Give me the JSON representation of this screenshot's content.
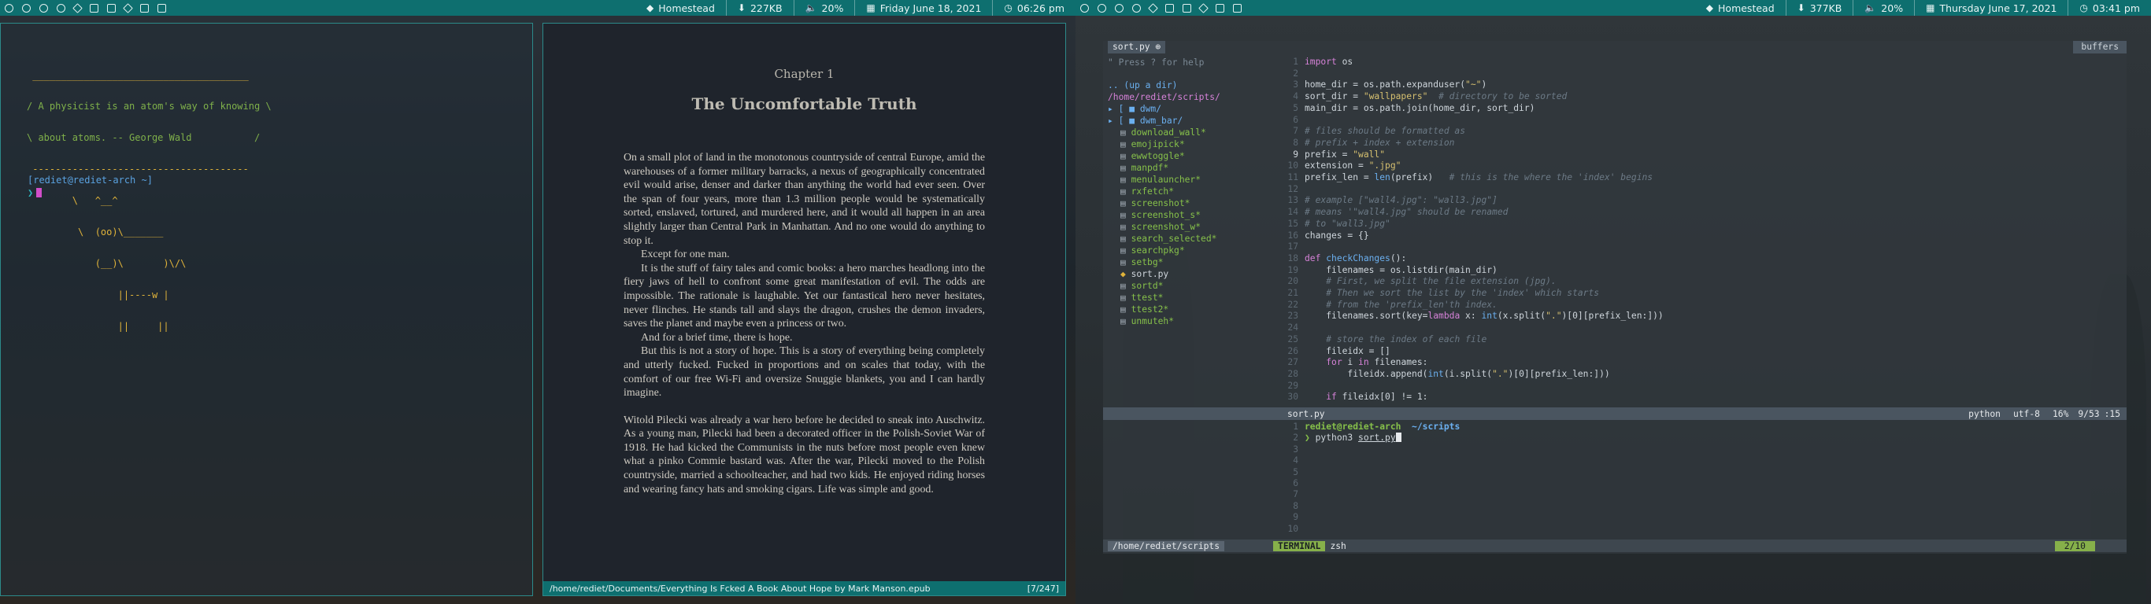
{
  "left_bar": {
    "network": "Homestead",
    "download": "227KB",
    "volume": "20%",
    "date": "Friday June 18, 2021",
    "time": "06:26 pm"
  },
  "right_bar": {
    "network": "Homestead",
    "download": "377KB",
    "volume": "20%",
    "date": "Thursday June 17, 2021",
    "time": "03:41 pm"
  },
  "terminal1": {
    "cowsay": [
      " ______________________________________",
      "/ A physicist is an atom's way of knowing \\",
      "\\ about atoms. -- George Wald           /",
      " --------------------------------------",
      "        \\   ^__^",
      "         \\  (oo)\\_______",
      "            (__)\\       )\\/\\",
      "                ||----w |",
      "                ||     ||"
    ],
    "prompt": "[rediet@rediet-arch ~",
    "prompt_end": "]",
    "cursor_glyph": "❯"
  },
  "reader": {
    "chapter": "Chapter 1",
    "title": "The Uncomfortable Truth",
    "paragraphs": [
      "On a small plot of land in the monotonous countryside of central Europe, amid the warehouses of a former military barracks, a nexus of geographically concentrated evil would arise, denser and darker than anything the world had ever seen. Over the span of four years, more than 1.3 million people would be systematically sorted, enslaved, tortured, and murdered here, and it would all happen in an area slightly larger than Central Park in Manhattan. And no one would do anything to stop it.",
      "Except for one man.",
      "It is the stuff of fairy tales and comic books: a hero marches headlong into the fiery jaws of hell to confront some great manifestation of evil. The odds are impossible. The rationale is laughable. Yet our fantastical hero never hesitates, never flinches. He stands tall and slays the dragon, crushes the demon invaders, saves the planet and maybe even a princess or two.",
      "And for a brief time, there is hope.",
      "But this is not a story of hope. This is a story of everything being completely and utterly fucked. Fucked in proportions and on scales that today, with the comfort of our free Wi-Fi and oversize Snuggie blankets, you and I can hardly imagine.",
      "Witold Pilecki was already a war hero before he decided to sneak into Auschwitz. As a young man, Pilecki had been a decorated officer in the Polish-Soviet War of 1918. He had kicked the Communists in the nuts before most people even knew what a pinko Commie bastard was. After the war, Pilecki moved to the Polish countryside, married a schoolteacher, and had two kids. He enjoyed riding horses and wearing fancy hats and smoking cigars. Life was simple and good."
    ],
    "path": "/home/rediet/Documents/Everything Is Fcked A Book About Hope by Mark Manson.epub",
    "page": "[7/247]"
  },
  "nvim": {
    "tab_name": "sort.py",
    "buffers_label": "buffers",
    "tree_help": "\" Press ? for help",
    "tree_up": ".. (up a dir)",
    "tree_cwd": "/home/rediet/scripts/",
    "tree_dirs": [
      "dwm/",
      "dwm_bar/"
    ],
    "tree_files": [
      "download_wall*",
      "emojipick*",
      "ewwtoggle*",
      "manpdf*",
      "menulauncher*",
      "rxfetch*",
      "screenshot*",
      "screenshot_s*",
      "screenshot_w*",
      "search_selected*",
      "searchpkg*",
      "setbg*",
      "sort.py",
      "sortd*",
      "ttest*",
      "ttest2*",
      "unmuteh*"
    ],
    "code_lines": [
      "import os",
      "",
      "home_dir = os.path.expanduser(\"~\")",
      "sort_dir = \"wallpapers\"  # directory to be sorted",
      "main_dir = os.path.join(home_dir, sort_dir)",
      "",
      "# files should be formatted as",
      "# prefix + index + extension",
      "prefix = \"wall\"",
      "extension = \".jpg\"",
      "prefix_len = len(prefix)   # this is the where the 'index' begins",
      "",
      "# example [\"wall4.jpg\": \"wall3.jpg\"]",
      "# means '\"wall4.jpg\" should be renamed",
      "# to \"wall3.jpg\"",
      "changes = {}",
      "",
      "def checkChanges():",
      "    filenames = os.listdir(main_dir)",
      "    # First, we split the file extension (jpg).",
      "    # Then we sort the list by the 'index' which starts",
      "    # from the 'prefix_len'th index.",
      "    filenames.sort(key=lambda x: int(x.split(\".\")[0][prefix_len:]))",
      "",
      "    # store the index of each file",
      "    fileidx = []",
      "    for i in filenames:",
      "        fileidx.append(int(i.split(\".\")[0][prefix_len:]))",
      "",
      "    if fileidx[0] != 1:"
    ],
    "status_file": "sort.py",
    "status_ft": "python",
    "status_enc": "utf-8",
    "status_pct": "16%",
    "status_pos": "9/53",
    "status_col": ":15",
    "term_prompt_user": "rediet@rediet-arch",
    "term_prompt_dir": "~/scripts",
    "term_cmd": "python3",
    "term_arg": "sort.py",
    "term_cursor": "❯",
    "status2_dir": "/home/rediet/scripts",
    "status2_mode": "TERMINAL",
    "status2_shell": "zsh",
    "status2_pos": "2/10"
  }
}
